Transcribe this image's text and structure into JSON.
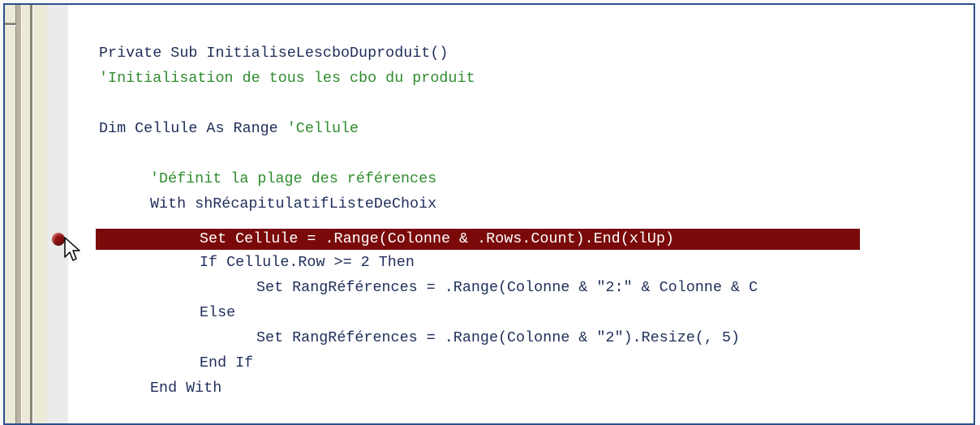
{
  "colors": {
    "keyword": "#1f2e5a",
    "comment": "#2f8c2f",
    "highlight_bg": "#7a0a0a",
    "highlight_fg": "#ffffff",
    "breakpoint": "#8b1010",
    "border": "#2b4f8a"
  },
  "code_lines": [
    {
      "indent": 0,
      "text": "Private Sub InitialiseLescboDuproduit()",
      "type": "plain"
    },
    {
      "indent": 0,
      "text": "'Initialisation de tous les cbo du produit",
      "type": "comment"
    },
    {
      "indent": 0,
      "text": "",
      "type": "blank"
    },
    {
      "indent": 0,
      "text": "Dim Cellule As Range ",
      "comment": "'Cellule",
      "type": "mixed"
    },
    {
      "indent": 0,
      "text": "",
      "type": "blank"
    },
    {
      "indent": 1,
      "text": "'Définit la plage des références",
      "type": "comment"
    },
    {
      "indent": 1,
      "text": "With shRécapitulatifListeDeChoix",
      "type": "plain"
    },
    {
      "indent": 2,
      "text": "Set Cellule = .Range(Colonne & .Rows.Count).End(xlUp)",
      "type": "highlight"
    },
    {
      "indent": 2,
      "text": "If Cellule.Row >= 2 Then",
      "type": "plain"
    },
    {
      "indent": 3,
      "text": "Set RangRéférences = .Range(Colonne & \"2:\" & Colonne & C",
      "type": "plain"
    },
    {
      "indent": 2,
      "text": "Else",
      "type": "plain"
    },
    {
      "indent": 3,
      "text": "Set RangRéférences = .Range(Colonne & \"2\").Resize(, 5)",
      "type": "plain"
    },
    {
      "indent": 2,
      "text": "End If",
      "type": "plain"
    },
    {
      "indent": 1,
      "text": "End With",
      "type": "plain"
    }
  ],
  "breakpoint": {
    "line_index": 7,
    "icon": "breakpoint-icon"
  },
  "cursor": {
    "icon": "mouse-pointer-icon"
  }
}
